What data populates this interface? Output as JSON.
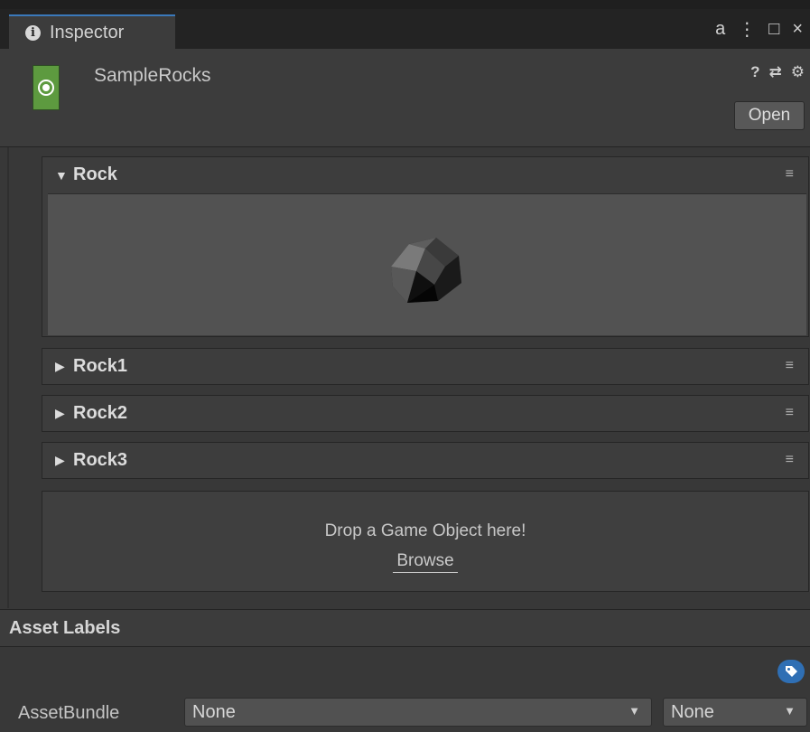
{
  "tab": {
    "label": "Inspector"
  },
  "tab_controls": {
    "lock": "a",
    "more": "⋮",
    "maximize": "□",
    "close": "×"
  },
  "header": {
    "asset_name": "SampleRocks",
    "help": "?",
    "settings_presets": "⇄",
    "gear": "⚙",
    "open_label": "Open"
  },
  "foldouts": [
    {
      "label": "Rock",
      "expanded": true,
      "menu": "≡"
    },
    {
      "label": "Rock1",
      "expanded": false,
      "menu": "≡"
    },
    {
      "label": "Rock2",
      "expanded": false,
      "menu": "≡"
    },
    {
      "label": "Rock3",
      "expanded": false,
      "menu": "≡"
    }
  ],
  "dropzone": {
    "message": "Drop a Game Object here!",
    "browse": "Browse"
  },
  "asset_labels": {
    "title": "Asset Labels",
    "assetbundle_label": "AssetBundle",
    "bundle_value": "None",
    "variant_value": "None"
  },
  "colors": {
    "accent": "#3a79bb",
    "asset_icon": "#5d9a3f",
    "tag_button": "#2f6fb4"
  }
}
